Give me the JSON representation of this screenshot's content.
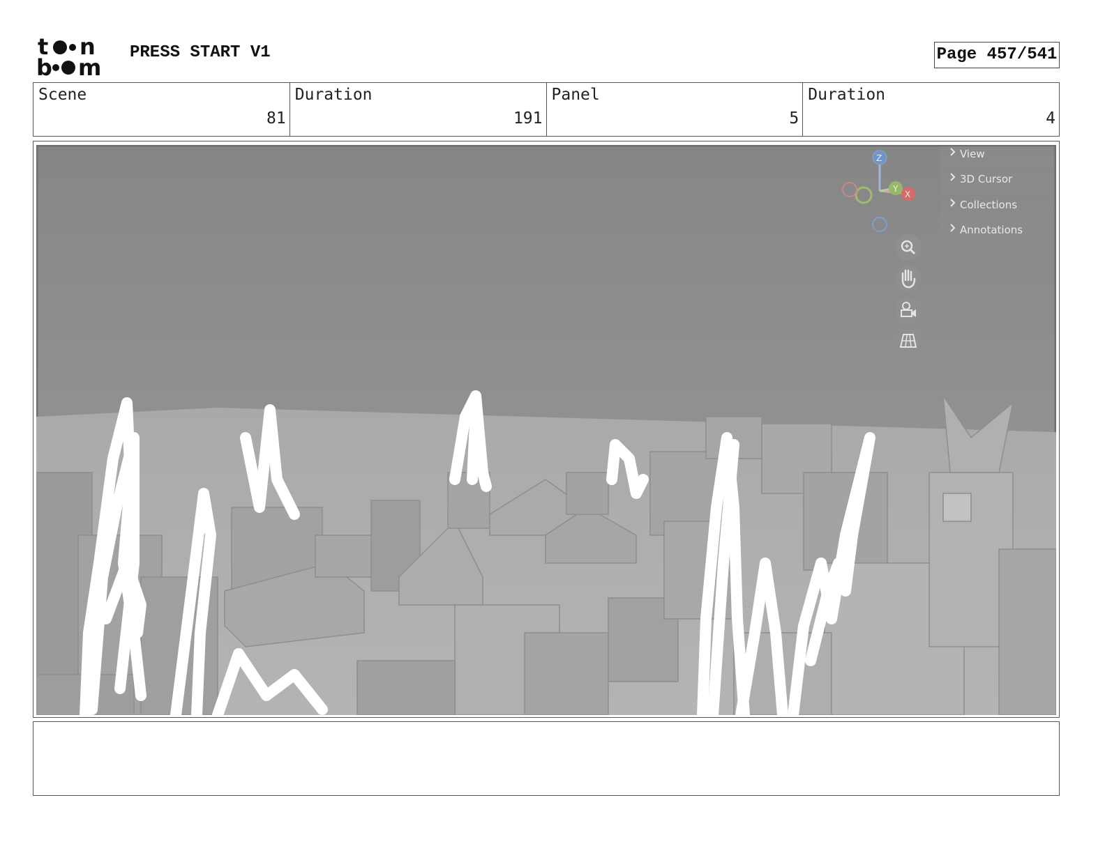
{
  "header": {
    "logo_top": "t o n",
    "logo_bottom": "b o m",
    "title": "PRESS START V1",
    "page": "Page 457/541"
  },
  "info": {
    "scene_label": "Scene",
    "scene_value": "81",
    "scene_duration_label": "Duration",
    "scene_duration_value": "191",
    "panel_label": "Panel",
    "panel_value": "5",
    "panel_duration_label": "Duration",
    "panel_duration_value": "4"
  },
  "viewport": {
    "menu_items": [
      "View",
      "3D Cursor",
      "Collections",
      "Annotations"
    ],
    "gizmo_axes": [
      "Z",
      "Y",
      "X"
    ],
    "tool_icons": [
      "zoom-icon",
      "hand-pan-icon",
      "camera-icon",
      "grid-perspective-icon"
    ]
  },
  "notes": {
    "text": ""
  }
}
